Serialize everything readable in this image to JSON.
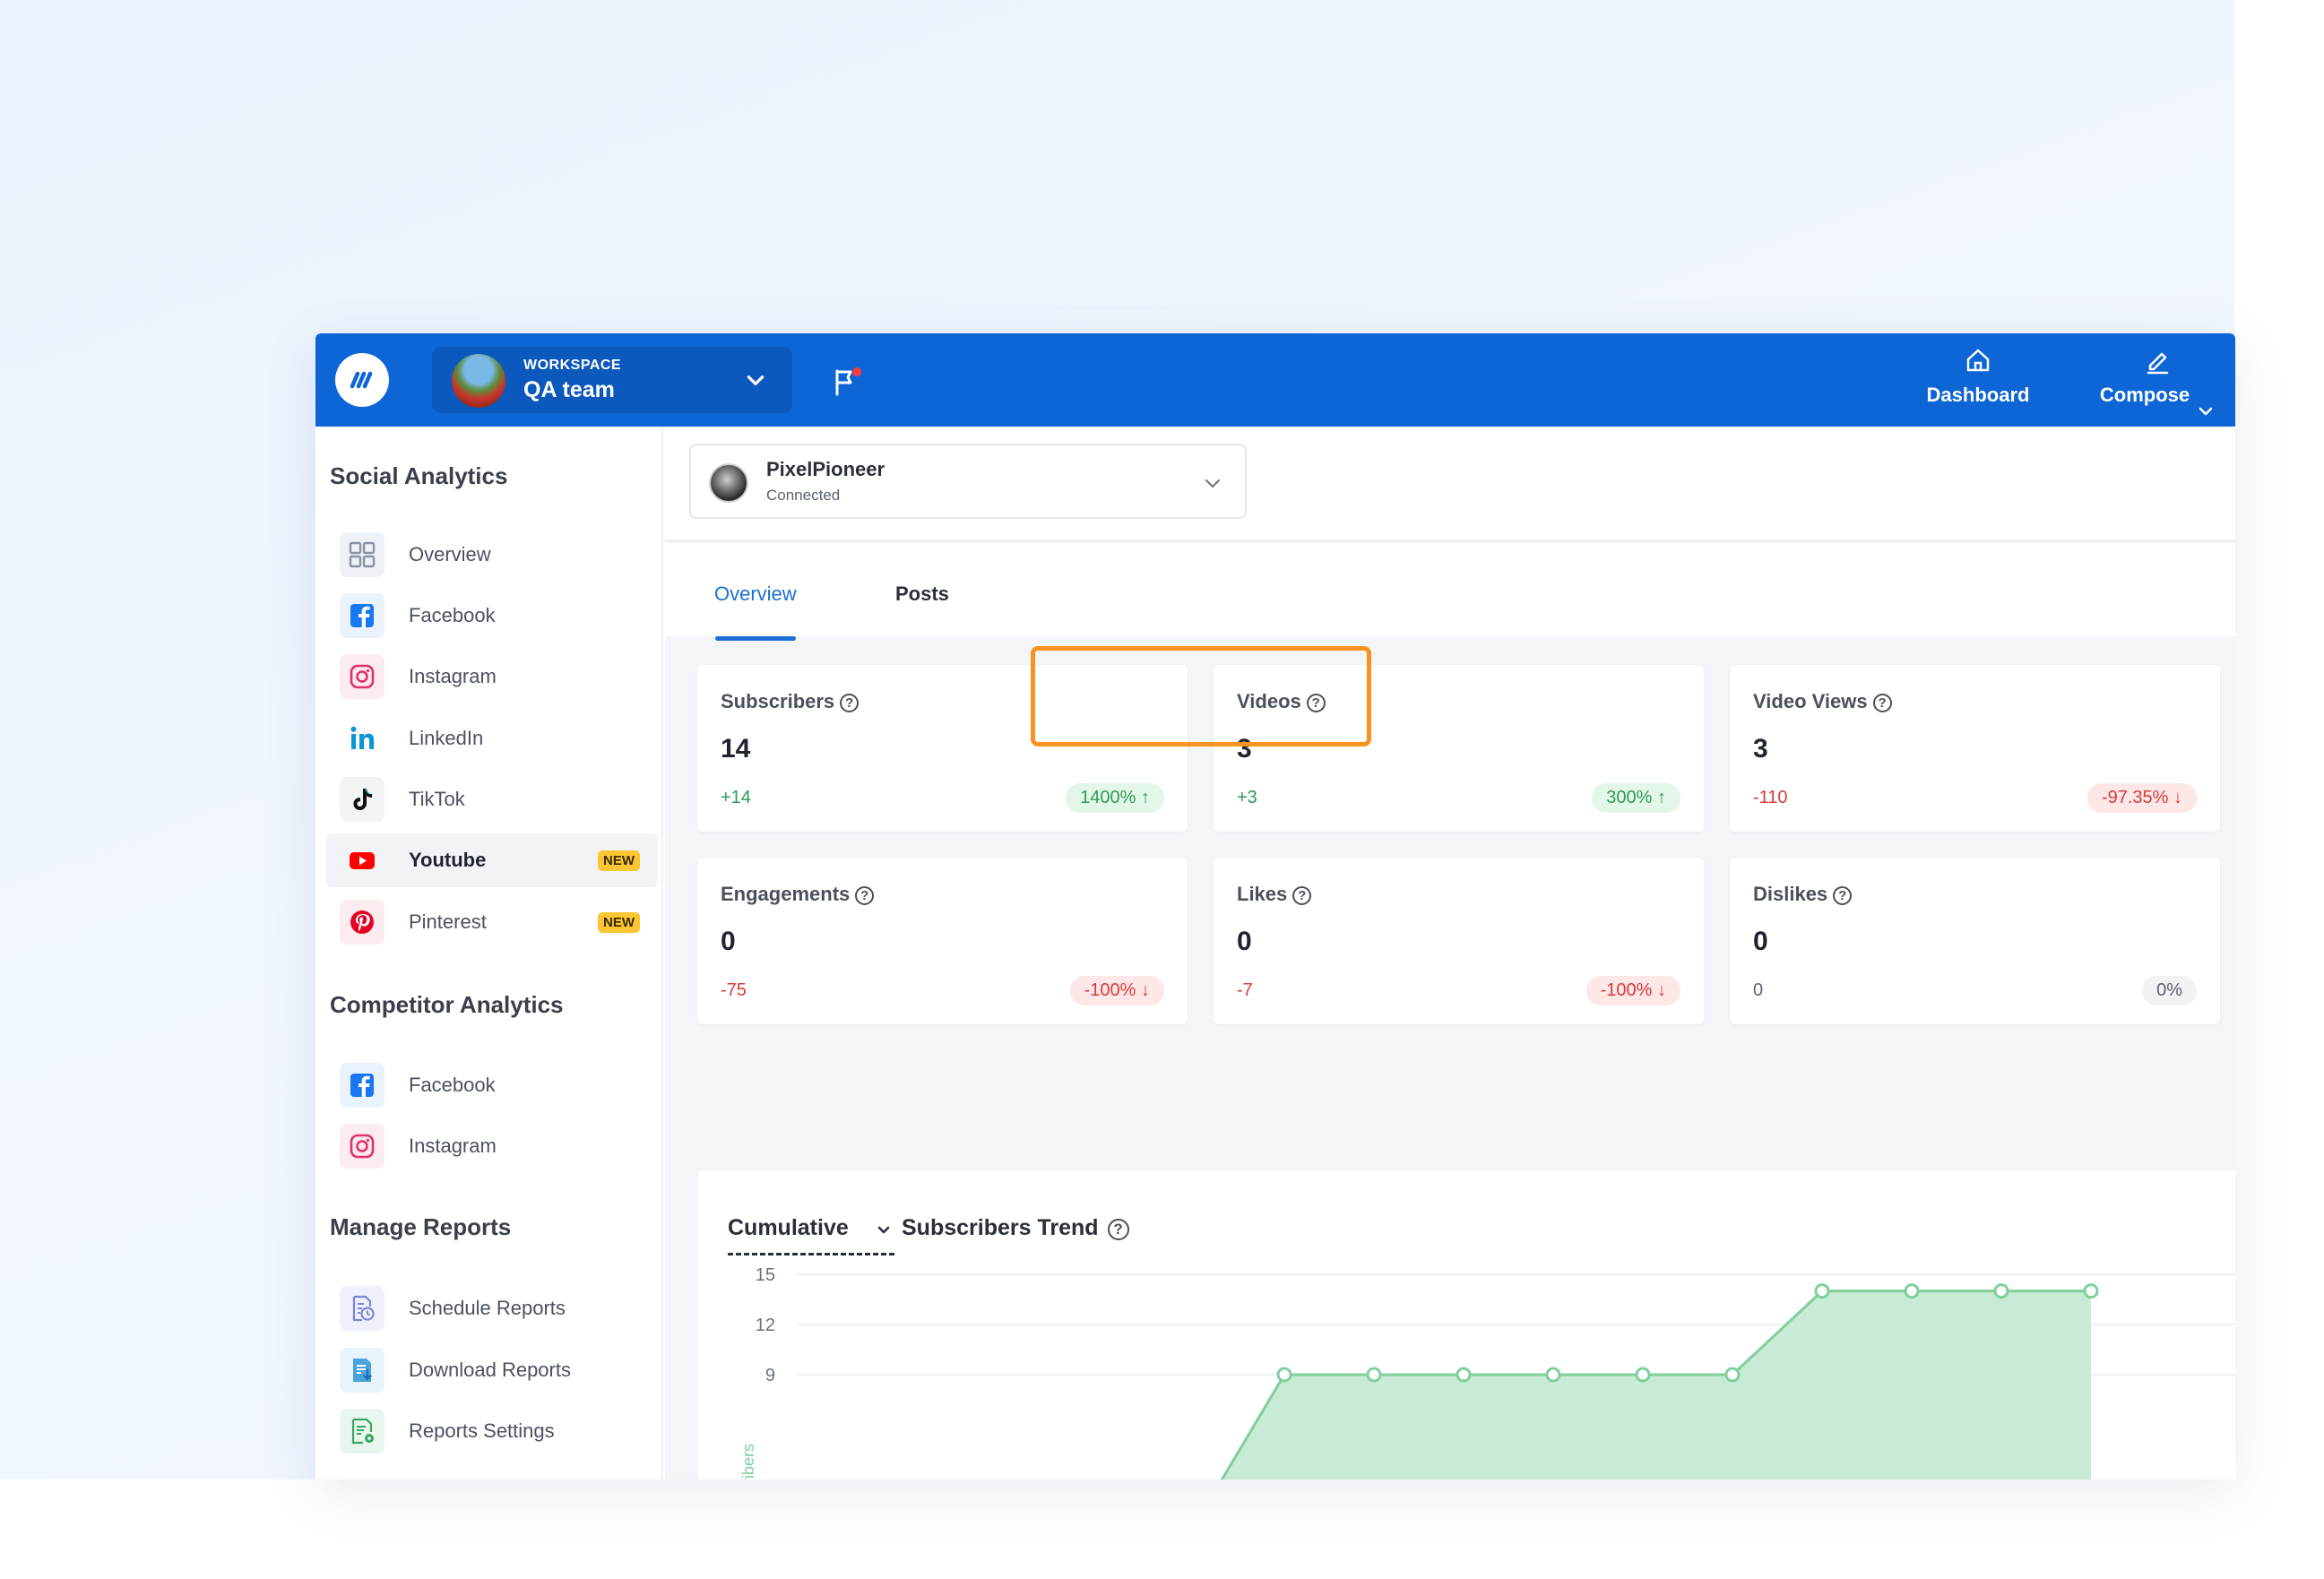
{
  "topbar": {
    "workspace_label": "WORKSPACE",
    "workspace_name": "QA team",
    "nav": {
      "dashboard": "Dashboard",
      "compose": "Compose"
    },
    "brand_color": "#0e66d6"
  },
  "sidebar": {
    "social_heading": "Social Analytics",
    "social_items": [
      {
        "label": "Overview",
        "icon": "grid-icon"
      },
      {
        "label": "Facebook",
        "icon": "facebook-icon"
      },
      {
        "label": "Instagram",
        "icon": "instagram-icon"
      },
      {
        "label": "LinkedIn",
        "icon": "linkedin-icon"
      },
      {
        "label": "TikTok",
        "icon": "tiktok-icon"
      },
      {
        "label": "Youtube",
        "icon": "youtube-icon",
        "badge": "NEW",
        "active": true
      },
      {
        "label": "Pinterest",
        "icon": "pinterest-icon",
        "badge": "NEW"
      }
    ],
    "competitor_heading": "Competitor Analytics",
    "competitor_items": [
      {
        "label": "Facebook",
        "icon": "facebook-icon"
      },
      {
        "label": "Instagram",
        "icon": "instagram-icon"
      }
    ],
    "reports_heading": "Manage Reports",
    "report_items": [
      {
        "label": "Schedule Reports",
        "icon": "schedule-report-icon"
      },
      {
        "label": "Download Reports",
        "icon": "download-report-icon"
      },
      {
        "label": "Reports Settings",
        "icon": "report-settings-icon"
      }
    ]
  },
  "account": {
    "name": "PixelPioneer",
    "status": "Connected"
  },
  "tabs": [
    {
      "label": "Overview",
      "active": true
    },
    {
      "label": "Posts",
      "active": false
    }
  ],
  "help_glyph": "?",
  "cards": [
    {
      "title": "Subscribers",
      "value": "14",
      "delta": "+14",
      "pct": "1400% ↑",
      "trend": "pos"
    },
    {
      "title": "Videos",
      "value": "3",
      "delta": "+3",
      "pct": "300% ↑",
      "trend": "pos"
    },
    {
      "title": "Video Views",
      "value": "3",
      "delta": "-110",
      "pct": "-97.35% ↓",
      "trend": "neg"
    },
    {
      "title": "Engagements",
      "value": "0",
      "delta": "-75",
      "pct": "-100% ↓",
      "trend": "neg"
    },
    {
      "title": "Likes",
      "value": "0",
      "delta": "-7",
      "pct": "-100% ↓",
      "trend": "neg"
    },
    {
      "title": "Dislikes",
      "value": "0",
      "delta": "0",
      "pct": "0%",
      "trend": "neu"
    }
  ],
  "chart": {
    "mode": "Cumulative",
    "title": "Subscribers Trend"
  },
  "chart_data": {
    "type": "area",
    "title": "Subscribers Trend",
    "ylabel": "Subscribers",
    "xlabel": "",
    "y_ticks": [
      9,
      12,
      15
    ],
    "ylim": [
      0,
      15
    ],
    "series": [
      {
        "name": "Subscribers",
        "values": [
          0,
          0,
          0,
          0,
          0,
          0,
          0,
          0,
          0,
          0,
          9,
          9,
          9,
          9,
          9,
          9,
          14,
          14,
          14,
          14
        ]
      }
    ],
    "color": "#7fcf9c",
    "fill": "#c8ebd6"
  }
}
